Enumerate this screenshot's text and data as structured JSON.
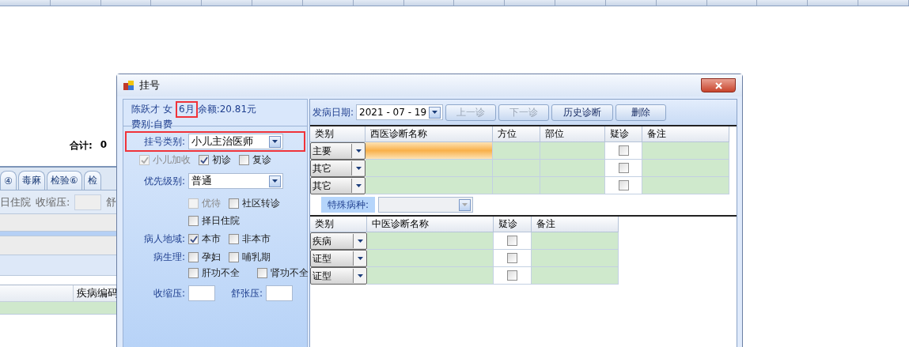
{
  "background": {
    "total": {
      "label": "合计:",
      "value": "0"
    },
    "tabs": [
      {
        "label": "④",
        "selected": false
      },
      {
        "label": "毒麻",
        "selected": false
      },
      {
        "label": "检验⑥",
        "selected": false
      },
      {
        "label": "检",
        "selected": false
      }
    ],
    "fields_row": {
      "label_1": "日住院",
      "label_2": "收缩压:",
      "label_3": "舒"
    },
    "table": {
      "columns": [
        "疾病编码"
      ]
    }
  },
  "dialog": {
    "title": "挂号",
    "patient": {
      "name": "陈跃才",
      "sex": "女",
      "age": "6月",
      "age_highlighted": true,
      "balance": "余额:20.81元",
      "fee_type": "费别:自费"
    },
    "register_type": {
      "label": "挂号类别:",
      "value": "小儿主治医师",
      "highlighted": true
    },
    "visit_checks": [
      {
        "label": "小儿加收",
        "checked": true,
        "disabled": true
      },
      {
        "label": "初诊",
        "checked": true,
        "disabled": false
      },
      {
        "label": "复诊",
        "checked": false,
        "disabled": false
      }
    ],
    "priority": {
      "label": "优先级别:",
      "value": "普通"
    },
    "priority_checks": [
      {
        "label": "优待",
        "checked": false,
        "disabled": true
      },
      {
        "label": "社区转诊",
        "checked": false,
        "disabled": false
      }
    ],
    "schedule_check": {
      "label": "择日住院",
      "checked": false
    },
    "region": {
      "label": "病人地域:",
      "options": [
        {
          "label": "本市",
          "checked": true
        },
        {
          "label": "非本市",
          "checked": false
        }
      ]
    },
    "physiology": {
      "label": "病生理:",
      "options": [
        {
          "label": "孕妇",
          "checked": false
        },
        {
          "label": "哺乳期",
          "checked": false
        },
        {
          "label": "肝功不全",
          "checked": false
        },
        {
          "label": "肾功不全",
          "checked": false
        }
      ]
    },
    "pressure": {
      "systolic_label": "收缩压:",
      "diastolic_label": "舒张压:"
    },
    "toolbar": {
      "date_label": "发病日期:",
      "date": "2021 - 07 - 19",
      "buttons": [
        {
          "label": "上一诊",
          "disabled": true
        },
        {
          "label": "下一诊",
          "disabled": true
        },
        {
          "label": "历史诊断",
          "disabled": false
        },
        {
          "label": "删除",
          "disabled": false
        }
      ]
    },
    "western_grid": {
      "columns": [
        "类别",
        "西医诊断名称",
        "方位",
        "部位",
        "疑诊",
        "备注"
      ],
      "rows": [
        {
          "category": "主要",
          "selected": true,
          "suspected": false
        },
        {
          "category": "其它",
          "selected": false,
          "suspected": false
        },
        {
          "category": "其它",
          "selected": false,
          "suspected": false
        }
      ]
    },
    "special_disease": {
      "label": "特殊病种:",
      "disabled": true
    },
    "tcm_grid": {
      "columns": [
        "类别",
        "中医诊断名称",
        "疑诊",
        "备注"
      ],
      "rows": [
        {
          "category": "疾病",
          "selected": false,
          "suspected": false
        },
        {
          "category": "证型",
          "selected": false,
          "suspected": false
        },
        {
          "category": "证型",
          "selected": false,
          "suspected": false
        }
      ]
    }
  }
}
